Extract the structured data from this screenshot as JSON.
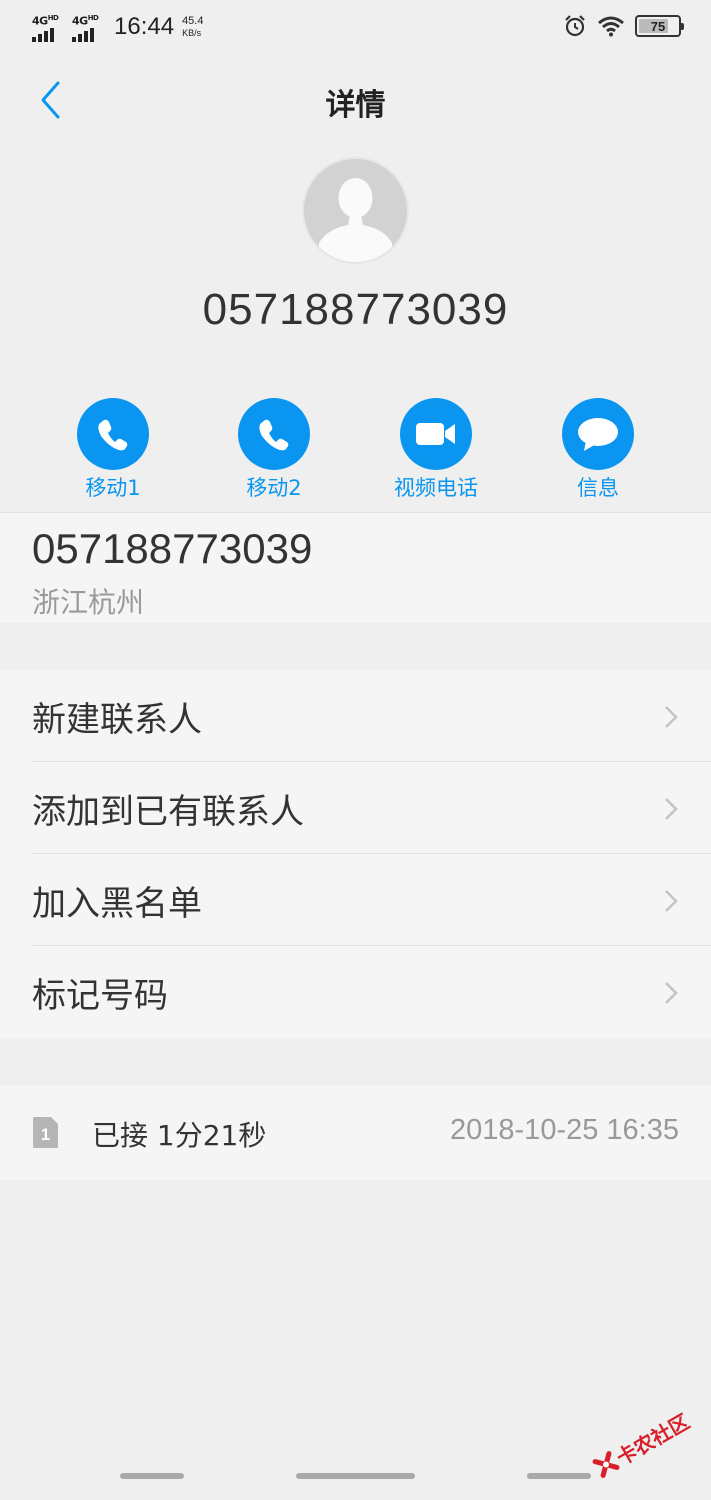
{
  "status_bar": {
    "sim1_network": "4G",
    "sim1_hd": "HD",
    "sim2_network": "4G",
    "sim2_hd": "HD",
    "time": "16:44",
    "speed_value": "45.4",
    "speed_unit": "KB/s",
    "battery_level": "75",
    "battery_fraction": 0.75
  },
  "header": {
    "title": "详情"
  },
  "contact": {
    "number": "057188773039"
  },
  "actions": [
    {
      "label": "移动1",
      "icon": "phone-icon"
    },
    {
      "label": "移动2",
      "icon": "phone-icon"
    },
    {
      "label": "视频电话",
      "icon": "video-camera-icon"
    },
    {
      "label": "信息",
      "icon": "message-bubble-icon"
    }
  ],
  "number_detail": {
    "number": "057188773039",
    "location": "浙江杭州"
  },
  "menu": [
    {
      "label": "新建联系人"
    },
    {
      "label": "添加到已有联系人"
    },
    {
      "label": "加入黑名单"
    },
    {
      "label": "标记号码"
    }
  ],
  "call_log": [
    {
      "sim": "1",
      "status": "已接 1分21秒",
      "time": "2018-10-25 16:35"
    }
  ],
  "watermark": {
    "text": "卡农社区"
  },
  "colors": {
    "accent": "#0a96f0",
    "background": "#efefef",
    "panel": "#f5f5f5",
    "watermark": "#d8202a"
  }
}
